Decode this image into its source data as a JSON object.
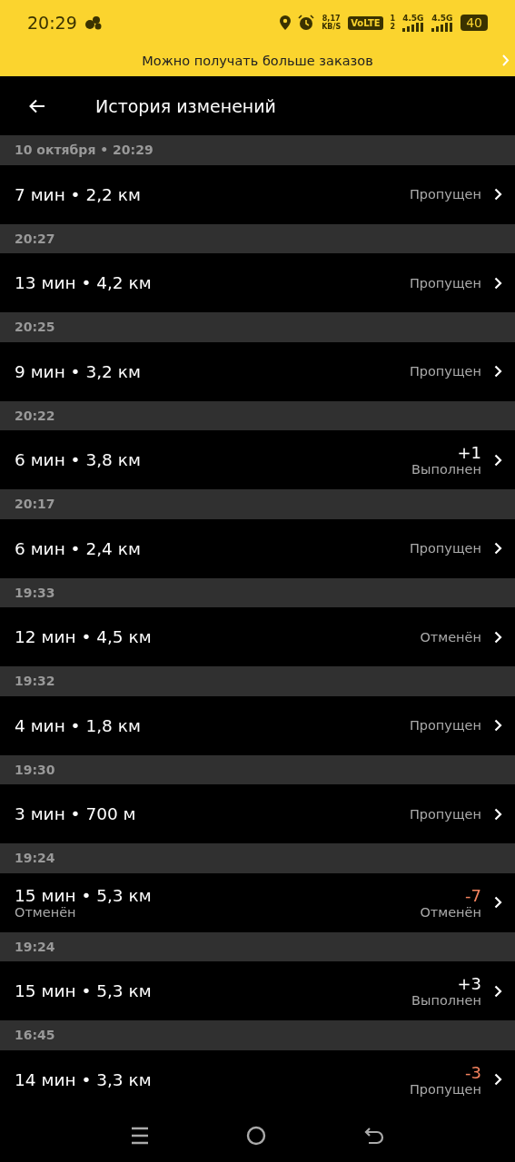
{
  "status_bar": {
    "time": "20:29",
    "net_speed": "8,17",
    "net_unit": "KB/S",
    "volte": "VoLTE",
    "sim_1": "1",
    "sim_2": "2",
    "network_1": "4.5G",
    "network_2": "4.5G",
    "battery": "40"
  },
  "banner": {
    "text": "Можно получать больше заказов"
  },
  "header": {
    "title": "История изменений"
  },
  "groups": [
    {
      "time": "10 октября • 20:29",
      "title": "7 мин • 2,2 км",
      "status": "Пропущен"
    },
    {
      "time": "20:27",
      "title": "13 мин • 4,2 км",
      "status": "Пропущен"
    },
    {
      "time": "20:25",
      "title": "9 мин • 3,2 км",
      "status": "Пропущен"
    },
    {
      "time": "20:22",
      "title": "6 мин • 3,8 км",
      "status": "Выполнен",
      "delta": {
        "text": "+1",
        "kind": "gain"
      }
    },
    {
      "time": "20:17",
      "title": "6 мин • 2,4 км",
      "status": "Пропущен"
    },
    {
      "time": "19:33",
      "title": "12 мин • 4,5 км",
      "status": "Отменён"
    },
    {
      "time": "19:32",
      "title": "4 мин • 1,8 км",
      "status": "Пропущен"
    },
    {
      "time": "19:30",
      "title": "3 мин • 700 м",
      "status": "Пропущен"
    },
    {
      "time": "19:24",
      "title": "15 мин • 5,3 км",
      "subtitle": "Отменён",
      "status": "Отменён",
      "delta": {
        "text": "-7",
        "kind": "loss"
      }
    },
    {
      "time": "19:24",
      "title": "15 мин • 5,3 км",
      "status": "Выполнен",
      "delta": {
        "text": "+3",
        "kind": "gain"
      }
    },
    {
      "time": "16:45",
      "title": "14 мин • 3,3 км",
      "status": "Пропущен",
      "delta": {
        "text": "-3",
        "kind": "loss"
      }
    }
  ]
}
